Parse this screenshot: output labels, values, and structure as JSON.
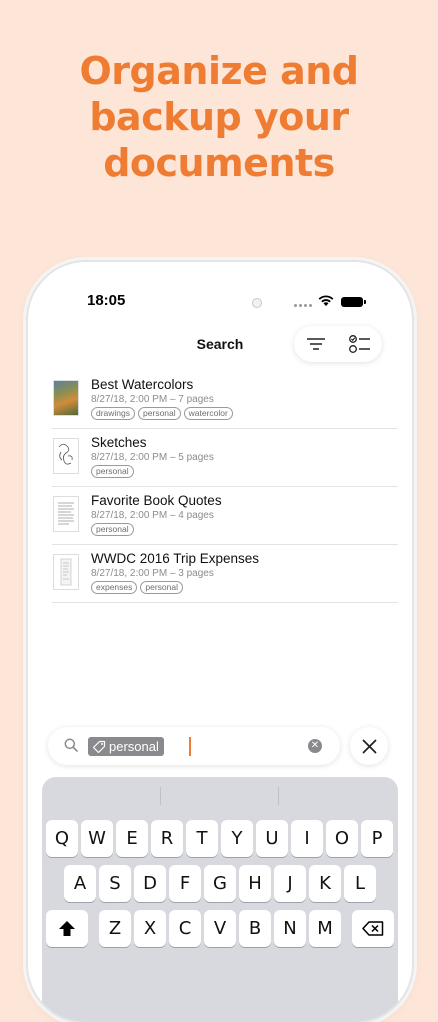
{
  "headline": {
    "line1": "Organize and",
    "line2": "backup your",
    "line3": "documents"
  },
  "status_bar": {
    "time": "18:05"
  },
  "nav": {
    "title": "Search"
  },
  "documents": [
    {
      "title": "Best Watercolors",
      "meta": "8/27/18, 2:00 PM – 7 pages",
      "tags": [
        "drawings",
        "personal",
        "watercolor"
      ]
    },
    {
      "title": "Sketches",
      "meta": "8/27/18, 2:00 PM – 5 pages",
      "tags": [
        "personal"
      ]
    },
    {
      "title": "Favorite Book Quotes",
      "meta": "8/27/18, 2:00 PM – 4 pages",
      "tags": [
        "personal"
      ]
    },
    {
      "title": "WWDC 2016 Trip Expenses",
      "meta": "8/27/18, 2:00 PM – 3 pages",
      "tags": [
        "expenses",
        "personal"
      ]
    }
  ],
  "search": {
    "token_label": "personal"
  },
  "keyboard": {
    "row1": [
      "Q",
      "W",
      "E",
      "R",
      "T",
      "Y",
      "U",
      "I",
      "O",
      "P"
    ],
    "row2": [
      "A",
      "S",
      "D",
      "F",
      "G",
      "H",
      "J",
      "K",
      "L"
    ],
    "row3": [
      "Z",
      "X",
      "C",
      "V",
      "B",
      "N",
      "M"
    ]
  },
  "colors": {
    "accent": "#ee7d33",
    "background": "#fde5d7"
  }
}
